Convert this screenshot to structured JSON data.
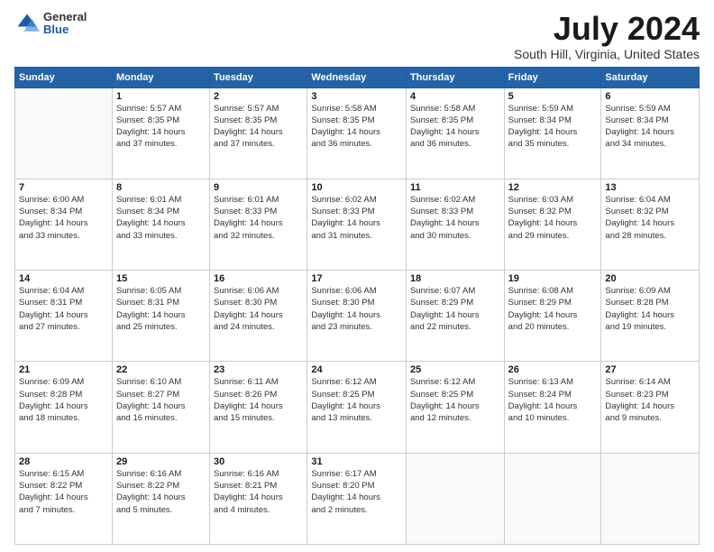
{
  "logo": {
    "general": "General",
    "blue": "Blue"
  },
  "title": "July 2024",
  "subtitle": "South Hill, Virginia, United States",
  "days_header": [
    "Sunday",
    "Monday",
    "Tuesday",
    "Wednesday",
    "Thursday",
    "Friday",
    "Saturday"
  ],
  "weeks": [
    [
      {
        "num": "",
        "info": ""
      },
      {
        "num": "1",
        "info": "Sunrise: 5:57 AM\nSunset: 8:35 PM\nDaylight: 14 hours\nand 37 minutes."
      },
      {
        "num": "2",
        "info": "Sunrise: 5:57 AM\nSunset: 8:35 PM\nDaylight: 14 hours\nand 37 minutes."
      },
      {
        "num": "3",
        "info": "Sunrise: 5:58 AM\nSunset: 8:35 PM\nDaylight: 14 hours\nand 36 minutes."
      },
      {
        "num": "4",
        "info": "Sunrise: 5:58 AM\nSunset: 8:35 PM\nDaylight: 14 hours\nand 36 minutes."
      },
      {
        "num": "5",
        "info": "Sunrise: 5:59 AM\nSunset: 8:34 PM\nDaylight: 14 hours\nand 35 minutes."
      },
      {
        "num": "6",
        "info": "Sunrise: 5:59 AM\nSunset: 8:34 PM\nDaylight: 14 hours\nand 34 minutes."
      }
    ],
    [
      {
        "num": "7",
        "info": "Sunrise: 6:00 AM\nSunset: 8:34 PM\nDaylight: 14 hours\nand 33 minutes."
      },
      {
        "num": "8",
        "info": "Sunrise: 6:01 AM\nSunset: 8:34 PM\nDaylight: 14 hours\nand 33 minutes."
      },
      {
        "num": "9",
        "info": "Sunrise: 6:01 AM\nSunset: 8:33 PM\nDaylight: 14 hours\nand 32 minutes."
      },
      {
        "num": "10",
        "info": "Sunrise: 6:02 AM\nSunset: 8:33 PM\nDaylight: 14 hours\nand 31 minutes."
      },
      {
        "num": "11",
        "info": "Sunrise: 6:02 AM\nSunset: 8:33 PM\nDaylight: 14 hours\nand 30 minutes."
      },
      {
        "num": "12",
        "info": "Sunrise: 6:03 AM\nSunset: 8:32 PM\nDaylight: 14 hours\nand 29 minutes."
      },
      {
        "num": "13",
        "info": "Sunrise: 6:04 AM\nSunset: 8:32 PM\nDaylight: 14 hours\nand 28 minutes."
      }
    ],
    [
      {
        "num": "14",
        "info": "Sunrise: 6:04 AM\nSunset: 8:31 PM\nDaylight: 14 hours\nand 27 minutes."
      },
      {
        "num": "15",
        "info": "Sunrise: 6:05 AM\nSunset: 8:31 PM\nDaylight: 14 hours\nand 25 minutes."
      },
      {
        "num": "16",
        "info": "Sunrise: 6:06 AM\nSunset: 8:30 PM\nDaylight: 14 hours\nand 24 minutes."
      },
      {
        "num": "17",
        "info": "Sunrise: 6:06 AM\nSunset: 8:30 PM\nDaylight: 14 hours\nand 23 minutes."
      },
      {
        "num": "18",
        "info": "Sunrise: 6:07 AM\nSunset: 8:29 PM\nDaylight: 14 hours\nand 22 minutes."
      },
      {
        "num": "19",
        "info": "Sunrise: 6:08 AM\nSunset: 8:29 PM\nDaylight: 14 hours\nand 20 minutes."
      },
      {
        "num": "20",
        "info": "Sunrise: 6:09 AM\nSunset: 8:28 PM\nDaylight: 14 hours\nand 19 minutes."
      }
    ],
    [
      {
        "num": "21",
        "info": "Sunrise: 6:09 AM\nSunset: 8:28 PM\nDaylight: 14 hours\nand 18 minutes."
      },
      {
        "num": "22",
        "info": "Sunrise: 6:10 AM\nSunset: 8:27 PM\nDaylight: 14 hours\nand 16 minutes."
      },
      {
        "num": "23",
        "info": "Sunrise: 6:11 AM\nSunset: 8:26 PM\nDaylight: 14 hours\nand 15 minutes."
      },
      {
        "num": "24",
        "info": "Sunrise: 6:12 AM\nSunset: 8:25 PM\nDaylight: 14 hours\nand 13 minutes."
      },
      {
        "num": "25",
        "info": "Sunrise: 6:12 AM\nSunset: 8:25 PM\nDaylight: 14 hours\nand 12 minutes."
      },
      {
        "num": "26",
        "info": "Sunrise: 6:13 AM\nSunset: 8:24 PM\nDaylight: 14 hours\nand 10 minutes."
      },
      {
        "num": "27",
        "info": "Sunrise: 6:14 AM\nSunset: 8:23 PM\nDaylight: 14 hours\nand 9 minutes."
      }
    ],
    [
      {
        "num": "28",
        "info": "Sunrise: 6:15 AM\nSunset: 8:22 PM\nDaylight: 14 hours\nand 7 minutes."
      },
      {
        "num": "29",
        "info": "Sunrise: 6:16 AM\nSunset: 8:22 PM\nDaylight: 14 hours\nand 5 minutes."
      },
      {
        "num": "30",
        "info": "Sunrise: 6:16 AM\nSunset: 8:21 PM\nDaylight: 14 hours\nand 4 minutes."
      },
      {
        "num": "31",
        "info": "Sunrise: 6:17 AM\nSunset: 8:20 PM\nDaylight: 14 hours\nand 2 minutes."
      },
      {
        "num": "",
        "info": ""
      },
      {
        "num": "",
        "info": ""
      },
      {
        "num": "",
        "info": ""
      }
    ]
  ]
}
